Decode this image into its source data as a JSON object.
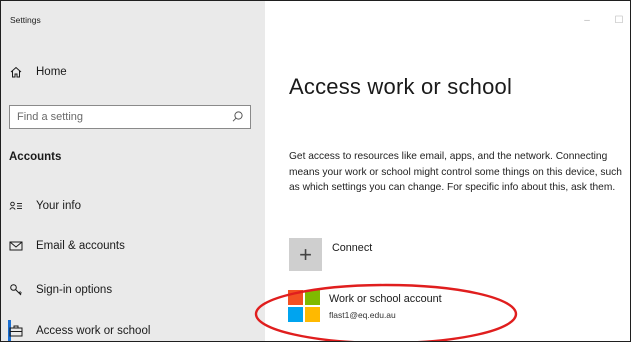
{
  "window": {
    "title": "Settings"
  },
  "window_controls": [
    {
      "name": "minimize",
      "glyph": "–"
    },
    {
      "name": "maximize",
      "glyph": "☐"
    }
  ],
  "sidebar": {
    "home": {
      "label": "Home",
      "icon": "home-icon"
    },
    "search": {
      "placeholder": "Find a setting",
      "value": "",
      "icon": "search-icon"
    },
    "section_heading": "Accounts",
    "items": [
      {
        "id": "your-info",
        "label": "Your info",
        "icon": "person-lines-icon"
      },
      {
        "id": "email-accounts",
        "label": "Email & accounts",
        "icon": "mail-icon"
      },
      {
        "id": "sign-in-options",
        "label": "Sign-in options",
        "icon": "key-icon"
      },
      {
        "id": "access-work-or-school",
        "label": "Access work or school",
        "icon": "briefcase-icon",
        "selected": true
      }
    ]
  },
  "main": {
    "title": "Access work or school",
    "description": "Get access to resources like email, apps, and the network. Connecting means your work or school might control some things on this device, such as which settings you can change. For specific info about this, ask them.",
    "connect": {
      "label": "Connect",
      "icon": "plus-icon"
    },
    "account": {
      "name": "Work or school account",
      "email": "flast1@eq.edu.au",
      "icon": "microsoft-logo-icon"
    }
  },
  "colors": {
    "sidebar_bg": "#eaeaea",
    "accent": "#1b6fd1",
    "annotation": "#e01e1e",
    "ms_red": "#f25022",
    "ms_green": "#7fba00",
    "ms_blue": "#00a4ef",
    "ms_yellow": "#ffb900"
  }
}
